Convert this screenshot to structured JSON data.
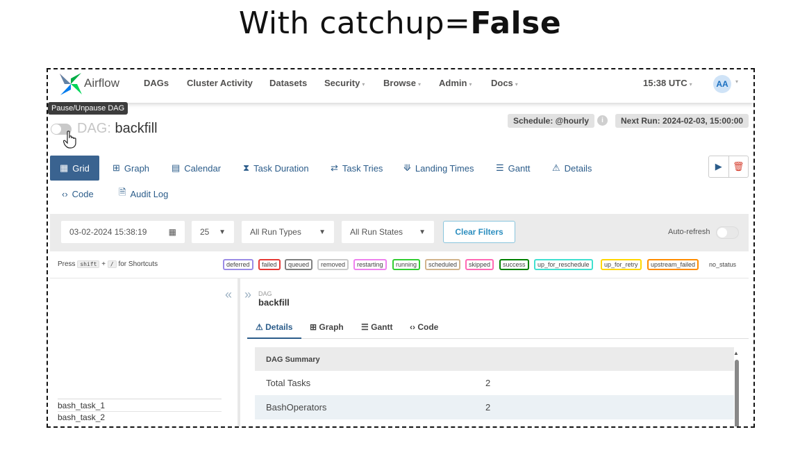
{
  "headline": {
    "prefix": "With catchup=",
    "bold": "False"
  },
  "navbar": {
    "brand": "Airflow",
    "items": [
      {
        "label": "DAGs",
        "caret": false
      },
      {
        "label": "Cluster Activity",
        "caret": false
      },
      {
        "label": "Datasets",
        "caret": false
      },
      {
        "label": "Security",
        "caret": true
      },
      {
        "label": "Browse",
        "caret": true
      },
      {
        "label": "Admin",
        "caret": true
      },
      {
        "label": "Docs",
        "caret": true
      }
    ],
    "time": "15:38 UTC",
    "avatar": "AA"
  },
  "tooltip": "Pause/Unpause DAG",
  "dag": {
    "prefix": "DAG:",
    "name": "backfill",
    "paused": true
  },
  "schedule_badge": "Schedule: @hourly",
  "next_run_badge": "Next Run: 2024-02-03, 15:00:00",
  "view_tabs": [
    {
      "label": "Grid",
      "icon": "grid-icon",
      "active": true
    },
    {
      "label": "Graph",
      "icon": "graph-icon"
    },
    {
      "label": "Calendar",
      "icon": "calendar-icon"
    },
    {
      "label": "Task Duration",
      "icon": "hourglass-icon"
    },
    {
      "label": "Task Tries",
      "icon": "retry-icon"
    },
    {
      "label": "Landing Times",
      "icon": "landing-icon"
    },
    {
      "label": "Gantt",
      "icon": "gantt-icon"
    },
    {
      "label": "Details",
      "icon": "warning-icon"
    },
    {
      "label": "Code",
      "icon": "code-icon"
    },
    {
      "label": "Audit Log",
      "icon": "audit-log-icon"
    }
  ],
  "filters": {
    "datetime": "03-02-2024 15:38:19",
    "num_runs": "25",
    "run_type": "All Run Types",
    "run_state": "All Run States",
    "clear_label": "Clear Filters",
    "auto_refresh_label": "Auto-refresh"
  },
  "shortcut": {
    "press": "Press",
    "key": "shift",
    "plus": "+",
    "slash": "/",
    "suffix": "for Shortcuts"
  },
  "states": [
    {
      "label": "deferred",
      "color": "#9b8ce6"
    },
    {
      "label": "failed",
      "color": "#e53935"
    },
    {
      "label": "queued",
      "color": "#808080"
    },
    {
      "label": "removed",
      "color": "#c8c8c8"
    },
    {
      "label": "restarting",
      "color": "#ee82ee"
    },
    {
      "label": "running",
      "color": "#32cd32"
    },
    {
      "label": "scheduled",
      "color": "#d2b48c"
    },
    {
      "label": "skipped",
      "color": "#ff69b4"
    },
    {
      "label": "success",
      "color": "#008000"
    },
    {
      "label": "up_for_reschedule",
      "color": "#40e0d0"
    },
    {
      "label": "up_for_retry",
      "color": "#ffd700"
    },
    {
      "label": "upstream_failed",
      "color": "#ff8c00"
    },
    {
      "label": "no_status",
      "color": "none"
    }
  ],
  "tasks": [
    "bash_task_1",
    "bash_task_2"
  ],
  "breadcrumb": {
    "small": "DAG",
    "name": "backfill"
  },
  "detail_tabs": [
    {
      "label": "Details",
      "icon": "warning-icon",
      "active": true
    },
    {
      "label": "Graph",
      "icon": "graph-icon"
    },
    {
      "label": "Gantt",
      "icon": "gantt-icon"
    },
    {
      "label": "Code",
      "icon": "code-icon"
    }
  ],
  "summary": {
    "header": "DAG Summary",
    "rows": [
      {
        "key": "Total Tasks",
        "value": "2"
      },
      {
        "key": "BashOperators",
        "value": "2"
      }
    ]
  },
  "colors": {
    "accent": "#3a6390",
    "link": "#2b5c8a",
    "clear": "#2c8ebf"
  }
}
